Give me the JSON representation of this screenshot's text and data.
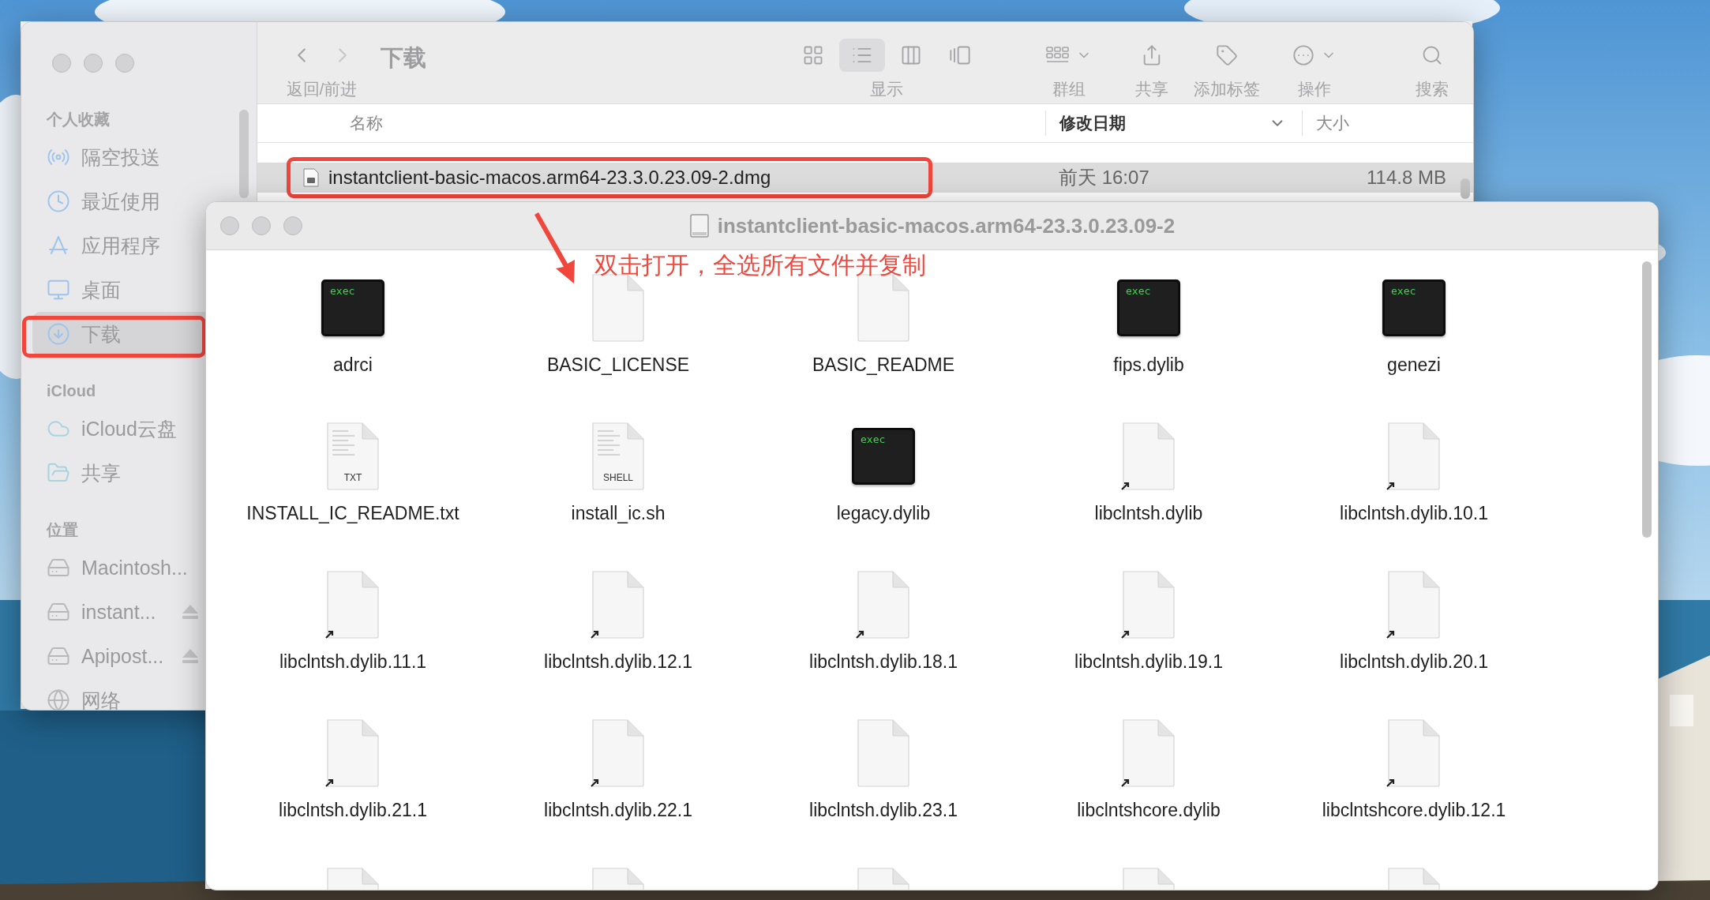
{
  "finder": {
    "sidebar": {
      "sections": [
        {
          "title": "个人收藏",
          "items": [
            {
              "label": "隔空投送",
              "kind": "airdrop",
              "selected": false
            },
            {
              "label": "最近使用",
              "kind": "recents",
              "selected": false
            },
            {
              "label": "应用程序",
              "kind": "apps",
              "selected": false
            },
            {
              "label": "桌面",
              "kind": "desktop",
              "selected": false
            },
            {
              "label": "下载",
              "kind": "downloads",
              "selected": true
            }
          ]
        },
        {
          "title": "iCloud",
          "items": [
            {
              "label": "iCloud云盘",
              "kind": "cloud",
              "selected": false
            },
            {
              "label": "共享",
              "kind": "shared",
              "selected": false
            }
          ]
        },
        {
          "title": "位置",
          "items": [
            {
              "label": "Macintosh...",
              "kind": "disk",
              "selected": false,
              "eject": false
            },
            {
              "label": "instant...",
              "kind": "disk",
              "selected": false,
              "eject": true
            },
            {
              "label": "Apipost...",
              "kind": "disk",
              "selected": false,
              "eject": true
            },
            {
              "label": "网络",
              "kind": "network",
              "selected": false,
              "eject": false
            }
          ]
        }
      ]
    },
    "toolbar": {
      "nav_label": "返回/前进",
      "title": "下载",
      "view_label": "显示",
      "views": [
        {
          "kind": "icons",
          "selected": false
        },
        {
          "kind": "list",
          "selected": true
        },
        {
          "kind": "columns",
          "selected": false
        },
        {
          "kind": "gallery",
          "selected": false
        }
      ],
      "actions": [
        {
          "label": "群组",
          "kind": "group"
        },
        {
          "label": "共享",
          "kind": "share"
        },
        {
          "label": "添加标签",
          "kind": "tag"
        },
        {
          "label": "操作",
          "kind": "more"
        },
        {
          "label": "搜索",
          "kind": "search"
        }
      ]
    },
    "columns": [
      {
        "label": "名称",
        "sorted": false
      },
      {
        "label": "修改日期",
        "sorted": true
      },
      {
        "label": "大小",
        "sorted": false
      }
    ],
    "rows": [
      {
        "name": "instantclient-basic-macos.arm64-23.3.0.23.09-2.dmg",
        "date": "前天 16:07",
        "size": "114.8 MB",
        "selected": true
      }
    ]
  },
  "disk_window": {
    "title": "instantclient-basic-macos.arm64-23.3.0.23.09-2",
    "files": [
      {
        "name": "adrci",
        "kind": "exec",
        "badge": "exec"
      },
      {
        "name": "BASIC_LICENSE",
        "kind": "doc"
      },
      {
        "name": "BASIC_README",
        "kind": "doc"
      },
      {
        "name": "fips.dylib",
        "kind": "exec",
        "badge": "exec"
      },
      {
        "name": "genezi",
        "kind": "exec",
        "badge": "exec"
      },
      {
        "name": "INSTALL_IC_README.txt",
        "kind": "text",
        "badge": "TXT"
      },
      {
        "name": "install_ic.sh",
        "kind": "text",
        "badge": "SHELL"
      },
      {
        "name": "legacy.dylib",
        "kind": "exec",
        "badge": "exec"
      },
      {
        "name": "libclntsh.dylib",
        "kind": "alias"
      },
      {
        "name": "libclntsh.dylib.10.1",
        "kind": "alias"
      },
      {
        "name": "libclntsh.dylib.11.1",
        "kind": "alias"
      },
      {
        "name": "libclntsh.dylib.12.1",
        "kind": "alias"
      },
      {
        "name": "libclntsh.dylib.18.1",
        "kind": "alias"
      },
      {
        "name": "libclntsh.dylib.19.1",
        "kind": "alias"
      },
      {
        "name": "libclntsh.dylib.20.1",
        "kind": "alias"
      },
      {
        "name": "libclntsh.dylib.21.1",
        "kind": "alias"
      },
      {
        "name": "libclntsh.dylib.22.1",
        "kind": "alias"
      },
      {
        "name": "libclntsh.dylib.23.1",
        "kind": "doc"
      },
      {
        "name": "libclntshcore.dylib",
        "kind": "alias"
      },
      {
        "name": "libclntshcore.dylib.12.1",
        "kind": "alias"
      },
      {
        "kind": "doc"
      },
      {
        "kind": "doc"
      },
      {
        "kind": "doc"
      },
      {
        "kind": "doc"
      },
      {
        "kind": "doc"
      }
    ]
  },
  "annotation": {
    "text": "双击打开，全选所有文件并复制"
  }
}
